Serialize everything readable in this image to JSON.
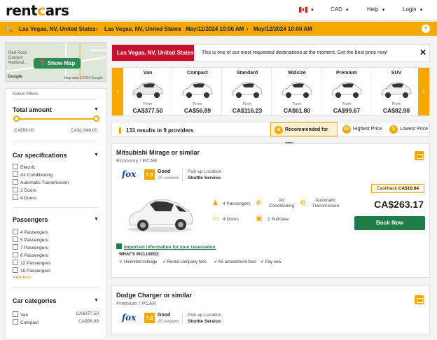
{
  "header": {
    "logo": "rentcars",
    "currency": "CAD",
    "help": "Help",
    "login": "Login"
  },
  "search": {
    "pickup_location": "Las Vegas, NV, United States",
    "dropoff_location": "Las Vegas, NV, United States",
    "pickup_datetime": "May/11/2024 10:00 AM",
    "dropoff_datetime": "May/12/2024 10:00 AM"
  },
  "map": {
    "button": "Show Map",
    "label_top": "Red Rock Canyon National...",
    "attribution": "Map data ©2024 Google",
    "google": "Google"
  },
  "filters": {
    "active": "Active Filters",
    "total_amount": "Total amount",
    "min_price": "CA$56.00",
    "max_price": "CA$1,646.00",
    "car_specs_title": "Car specifications",
    "car_specs": [
      "Electric",
      "Air Conditioning",
      "Automatic Transmission",
      "2 Doors",
      "4 Doors"
    ],
    "passengers_title": "Passengers",
    "passengers": [
      "4 Passengers",
      "5 Passengers",
      "7 Passengers",
      "8 Passengers",
      "12 Passengers",
      "15 Passengers"
    ],
    "view_less": "view less",
    "categories_title": "Car categories",
    "categories": [
      {
        "name": "Van",
        "price": "CA$377.50"
      },
      {
        "name": "Compact",
        "price": "CA$56.89"
      }
    ]
  },
  "alert": {
    "tag": "Las Vegas, NV, United States",
    "message": "This is one of our most requested destinations at the moment. Get the best price now!"
  },
  "carousel": {
    "from": "From",
    "items": [
      {
        "name": "Van",
        "price": "CA$377.50"
      },
      {
        "name": "Compact",
        "price": "CA$56.89"
      },
      {
        "name": "Standard",
        "price": "CA$116.23"
      },
      {
        "name": "Midsize",
        "price": "CA$61.80"
      },
      {
        "name": "Premium",
        "price": "CA$99.67"
      },
      {
        "name": "SUV",
        "price": "CA$82.98"
      }
    ]
  },
  "results": {
    "count": "131 results in 9 providers",
    "sort_recommended": "Recommended for you",
    "sort_highest": "Highest Price",
    "sort_lowest": "Lowest Price"
  },
  "cards": [
    {
      "title": "Mitsubishi Mirage or similar",
      "subtitle": "Economy / ECAR",
      "provider": "fox",
      "score": "7.5",
      "rating": "Good",
      "reviews": "15 reviews",
      "pickup_label": "Pick-up Location",
      "pickup_value": "Shuttle Service",
      "passengers": "4 Passengers",
      "ac": "Air Conditioning",
      "transmission": "Automatic Transmission",
      "doors": "4 Doors",
      "luggage": "1 Suitcase",
      "cashback_label": "Cashback",
      "cashback_value": "CA$10.84",
      "price": "CA$263.17",
      "book": "Book Now",
      "info_link": "Important information for your reservation",
      "included_title": "WHAT'S INCLUDED:",
      "included": [
        "Unlimited mileage",
        "Rental company fees",
        "No amendment fees",
        "Pay now"
      ]
    },
    {
      "title": "Dodge Charger or similar",
      "subtitle": "Premium / PCAR",
      "provider": "fox",
      "score": "7.5",
      "rating": "Good",
      "reviews": "15 reviews",
      "pickup_label": "Pick-up Location",
      "pickup_value": "Shuttle Service"
    }
  ],
  "colors": {
    "accent": "#f5a800",
    "alert": "#c8102e",
    "book": "#1e7c46"
  }
}
